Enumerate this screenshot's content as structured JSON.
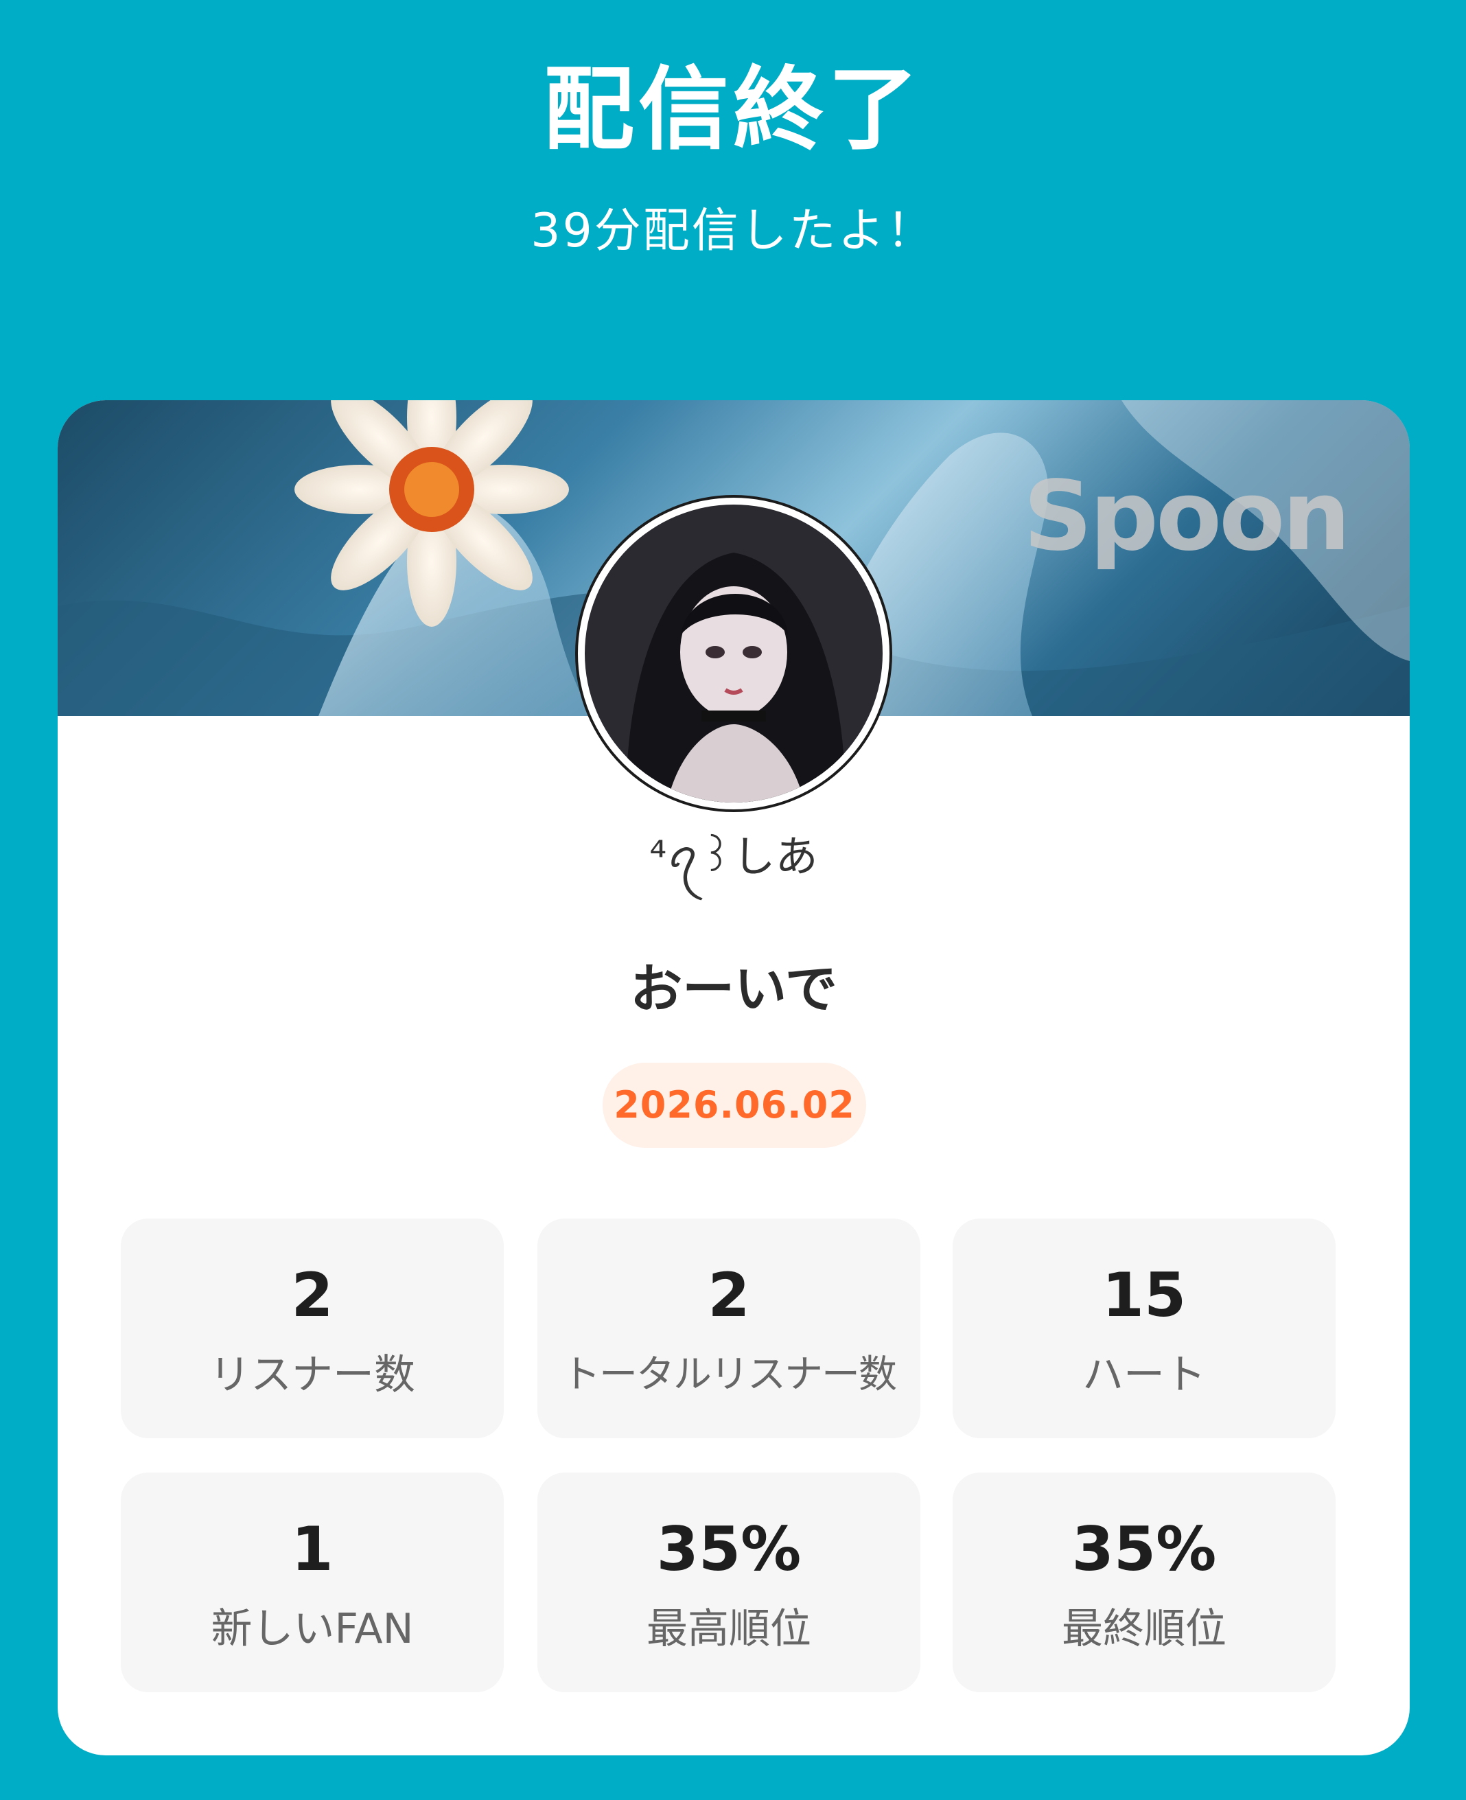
{
  "header": {
    "title": "配信終了",
    "subtitle": "39分配信したよ！"
  },
  "card": {
    "banner_logo": "Spoon",
    "avatar_icon": "avatar-icon",
    "username": "⁴ꪖ꒱しあ",
    "stream_title": "おーいで",
    "date": "2026.06.02",
    "accent_color": "#ff6a2a",
    "stats": [
      {
        "value": "2",
        "label": "リスナー数"
      },
      {
        "value": "2",
        "label": "トータルリスナー数"
      },
      {
        "value": "15",
        "label": "ハート"
      },
      {
        "value": "1",
        "label": "新しいFAN"
      },
      {
        "value": "35%",
        "label": "最高順位"
      },
      {
        "value": "35%",
        "label": "最終順位"
      }
    ]
  }
}
